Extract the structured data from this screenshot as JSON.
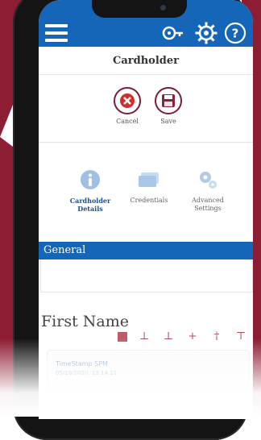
{
  "header": {
    "menu_icon": "hamburger-icon",
    "icons": [
      "key-icon",
      "gear-icon",
      "help-icon"
    ]
  },
  "page": {
    "title": "Cardholder"
  },
  "actions": {
    "cancel_label": "Cancel",
    "save_label": "Save"
  },
  "tabs": [
    {
      "label_line1": "Cardholder",
      "label_line2": "Details",
      "icon": "info-icon",
      "active": true
    },
    {
      "label_line1": "Credentials",
      "label_line2": "",
      "icon": "credentials-icon",
      "active": false
    },
    {
      "label_line1": "Advanced",
      "label_line2": "Settings",
      "icon": "gears-icon",
      "active": false
    }
  ],
  "section": {
    "title": "General"
  },
  "field": {
    "label": "First Name"
  },
  "card": {
    "title": "TimeStamp SPM",
    "date": "05/19/2020, 13:14:11"
  },
  "colors": {
    "primary": "#1565b8",
    "accent": "#7a1f33",
    "background_wedge": "#8c1d32"
  }
}
